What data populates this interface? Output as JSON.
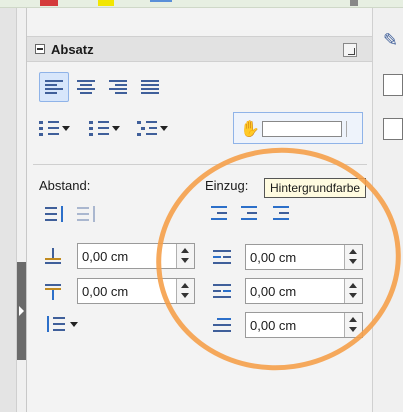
{
  "panel": {
    "section_title": "Absatz"
  },
  "spacing": {
    "label": "Abstand:",
    "above_value": "0,00 cm",
    "below_value": "0,00 cm"
  },
  "indent": {
    "label": "Einzug:",
    "before_value": "0,00 cm",
    "after_value": "0,00 cm",
    "first_line_value": "0,00 cm"
  },
  "tooltip": {
    "text": "Hintergrundfarbe"
  },
  "colors": {
    "accent_blue": "#3f5f9a",
    "annotation": "#f5a04a",
    "active_bg": "#d7e6fb"
  }
}
